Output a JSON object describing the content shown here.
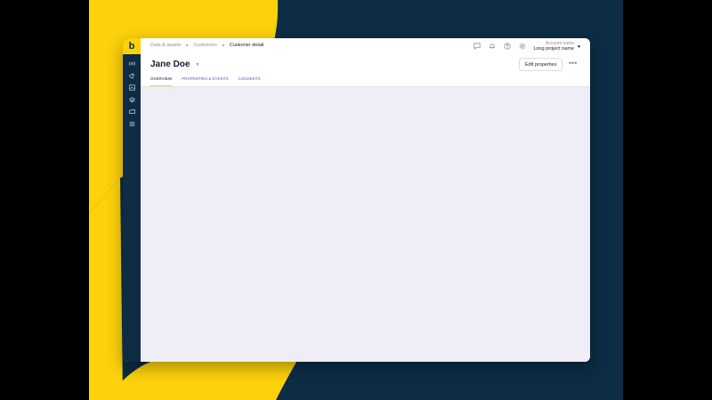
{
  "colors": {
    "brand_yellow": "#fdd20a",
    "navy": "#0c2d44",
    "content_bg": "#efedf6"
  },
  "brand": {
    "logo_letter": "b"
  },
  "sidebar": {
    "items": [
      {
        "icon": "broadcast-icon"
      },
      {
        "icon": "megaphone-icon"
      },
      {
        "icon": "image-icon"
      },
      {
        "icon": "layers-icon"
      },
      {
        "icon": "folder-icon"
      },
      {
        "icon": "menu-icon"
      }
    ]
  },
  "breadcrumb": {
    "items": [
      "Data & assets",
      "Customers",
      "Customer detail"
    ]
  },
  "topbar": {
    "icons": [
      "chat-icon",
      "bell-icon",
      "help-icon",
      "settings-icon"
    ],
    "account_name": "Account name",
    "project_name": "Long project name"
  },
  "page": {
    "title": "Jane Doe",
    "edit_button": "Edit properties",
    "more_label": "•••"
  },
  "tabs": [
    {
      "label": "OVERVIEW",
      "active": true
    },
    {
      "label": "PROPERTIES & EVENTS",
      "active": false
    },
    {
      "label": "CONSENTS",
      "active": false
    }
  ]
}
